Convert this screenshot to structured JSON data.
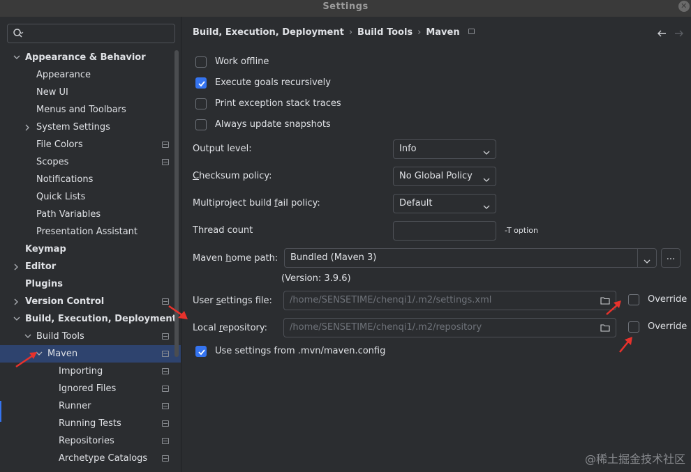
{
  "window": {
    "title": "Settings"
  },
  "search": {
    "placeholder": ""
  },
  "sidebar": {
    "items": [
      {
        "label": "Appearance & Behavior",
        "level": 0,
        "bold": true,
        "expanded": true,
        "has_arrow": true,
        "pinned": false
      },
      {
        "label": "Appearance",
        "level": 1,
        "bold": false,
        "pinned": false
      },
      {
        "label": "New UI",
        "level": 1,
        "bold": false,
        "pinned": false
      },
      {
        "label": "Menus and Toolbars",
        "level": 1,
        "bold": false,
        "pinned": false
      },
      {
        "label": "System Settings",
        "level": 1,
        "bold": false,
        "has_arrow": true,
        "expanded": false,
        "pinned": false
      },
      {
        "label": "File Colors",
        "level": 1,
        "bold": false,
        "pinned": true
      },
      {
        "label": "Scopes",
        "level": 1,
        "bold": false,
        "pinned": true
      },
      {
        "label": "Notifications",
        "level": 1,
        "bold": false,
        "pinned": false
      },
      {
        "label": "Quick Lists",
        "level": 1,
        "bold": false,
        "pinned": false
      },
      {
        "label": "Path Variables",
        "level": 1,
        "bold": false,
        "pinned": false
      },
      {
        "label": "Presentation Assistant",
        "level": 1,
        "bold": false,
        "pinned": false
      },
      {
        "label": "Keymap",
        "level": 0,
        "bold": true,
        "pinned": false
      },
      {
        "label": "Editor",
        "level": 0,
        "bold": true,
        "has_arrow": true,
        "expanded": false,
        "pinned": false
      },
      {
        "label": "Plugins",
        "level": 0,
        "bold": true,
        "pinned": false
      },
      {
        "label": "Version Control",
        "level": 0,
        "bold": true,
        "has_arrow": true,
        "expanded": false,
        "pinned": true
      },
      {
        "label": "Build, Execution, Deployment",
        "level": 0,
        "bold": true,
        "has_arrow": true,
        "expanded": true,
        "pinned": false
      },
      {
        "label": "Build Tools",
        "level": 1,
        "bold": false,
        "has_arrow": true,
        "expanded": true,
        "pinned": true
      },
      {
        "label": "Maven",
        "level": 2,
        "bold": false,
        "has_arrow": true,
        "expanded": true,
        "pinned": true,
        "selected": true
      },
      {
        "label": "Importing",
        "level": 3,
        "bold": false,
        "pinned": true
      },
      {
        "label": "Ignored Files",
        "level": 3,
        "bold": false,
        "pinned": true
      },
      {
        "label": "Runner",
        "level": 3,
        "bold": false,
        "pinned": true
      },
      {
        "label": "Running Tests",
        "level": 3,
        "bold": false,
        "pinned": true
      },
      {
        "label": "Repositories",
        "level": 3,
        "bold": false,
        "pinned": true
      },
      {
        "label": "Archetype Catalogs",
        "level": 3,
        "bold": false,
        "pinned": true
      }
    ]
  },
  "breadcrumb": [
    "Build, Execution, Deployment",
    "Build Tools",
    "Maven"
  ],
  "options": {
    "work_offline": {
      "label": "Work offline",
      "checked": false
    },
    "execute_recursively": {
      "label": "Execute goals recursively",
      "checked": true
    },
    "print_stack_traces": {
      "label": "Print exception stack traces",
      "checked": false
    },
    "always_update_snapshots": {
      "label": "Always update snapshots",
      "checked": false
    }
  },
  "form": {
    "output_level": {
      "label": "Output level:",
      "value": "Info"
    },
    "checksum_policy": {
      "label_pre": "",
      "label_u": "C",
      "label_post": "hecksum policy:",
      "value": "No Global Policy"
    },
    "multiproject_fail": {
      "label_pre": "Multiproject build ",
      "label_u": "f",
      "label_post": "ail policy:",
      "value": "Default"
    },
    "thread_count": {
      "label": "Thread count",
      "value": "",
      "hint": "-T option"
    },
    "maven_home": {
      "label_pre": "Maven ",
      "label_u": "h",
      "label_post": "ome path:",
      "value": "Bundled (Maven 3)",
      "version": "(Version: 3.9.6)",
      "browse_label": "..."
    },
    "user_settings": {
      "label_pre": "User ",
      "label_u": "s",
      "label_post": "ettings file:",
      "value": "/home/SENSETIME/chenqi1/.m2/settings.xml",
      "override_label": "Override",
      "override_checked": false
    },
    "local_repo": {
      "label_pre": "Local ",
      "label_u": "r",
      "label_post": "epository:",
      "value": "/home/SENSETIME/chenqi1/.m2/repository",
      "override_label": "Override",
      "override_checked": false
    },
    "use_mvn_config": {
      "label": "Use settings from .mvn/maven.config",
      "checked": true
    }
  },
  "watermark": "@稀土掘金技术社区",
  "colors": {
    "accent": "#3574f0",
    "selected_bg": "#2e436e",
    "annotation": "#e8322c"
  }
}
